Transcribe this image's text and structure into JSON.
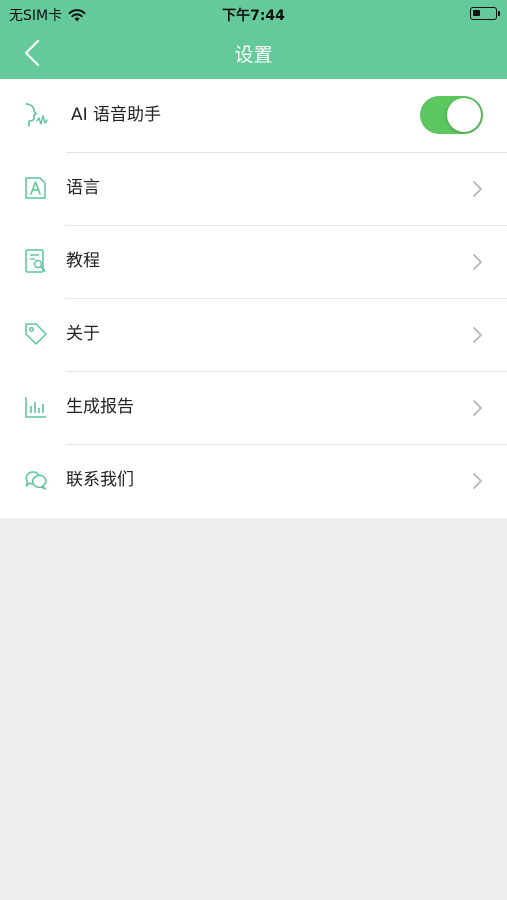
{
  "status_bar": {
    "carrier": "无SIM卡",
    "time": "下午7:44"
  },
  "nav": {
    "title": "设置",
    "back_icon": "chevron-left-icon"
  },
  "settings": {
    "items": [
      {
        "label": "AI 语音助手",
        "icon": "voice-assistant-icon",
        "control": "toggle",
        "toggle_on": true
      },
      {
        "label": "语言",
        "icon": "language-icon",
        "control": "chevron"
      },
      {
        "label": "教程",
        "icon": "tutorial-icon",
        "control": "chevron"
      },
      {
        "label": "关于",
        "icon": "tag-icon",
        "control": "chevron"
      },
      {
        "label": "生成报告",
        "icon": "report-chart-icon",
        "control": "chevron"
      },
      {
        "label": "联系我们",
        "icon": "chat-bubbles-icon",
        "control": "chevron"
      }
    ]
  },
  "colors": {
    "header": "#64c99b",
    "icon_accent": "#5cc59a",
    "toggle_on": "#5cc65f",
    "background": "#efefef"
  }
}
